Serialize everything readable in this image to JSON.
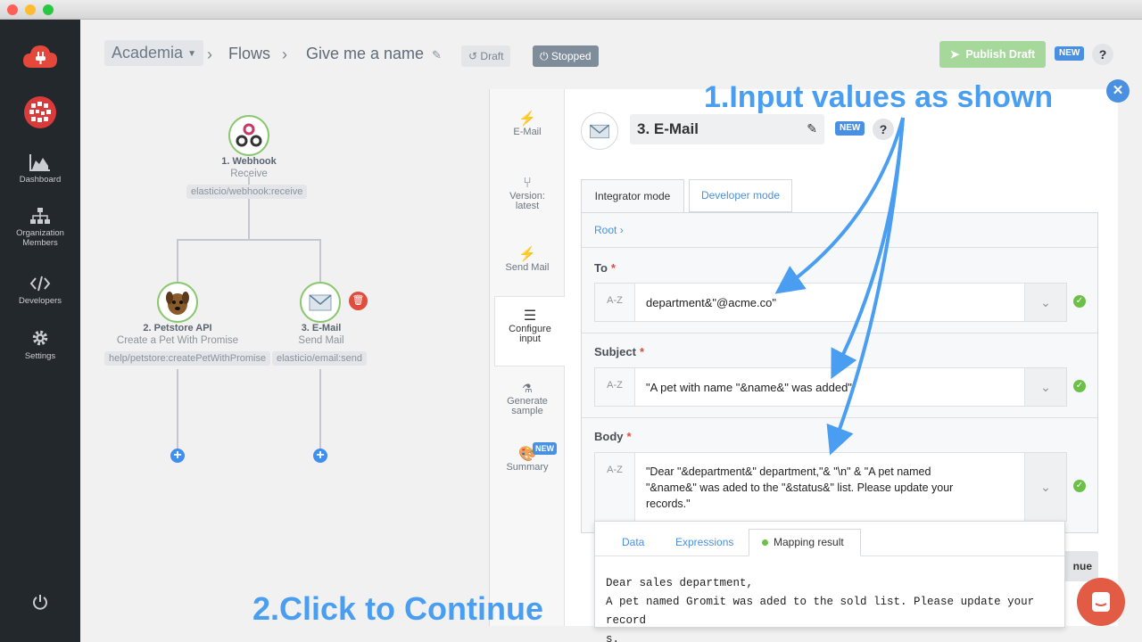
{
  "window": {
    "traffic_lights": [
      "#ff5f57",
      "#febc2e",
      "#28c840"
    ]
  },
  "sidebar": {
    "items": [
      {
        "label": "Dashboard",
        "icon": "area-chart-icon"
      },
      {
        "label": "Organization Members",
        "icon": "org-chart-icon"
      },
      {
        "label": "Developers",
        "icon": "code-icon"
      },
      {
        "label": "Settings",
        "icon": "gear-icon"
      }
    ],
    "logout_icon": "power-icon"
  },
  "header": {
    "workspace": "Academia",
    "flows": "Flows",
    "flow_name": "Give me a name",
    "draft_label": "Draft",
    "status_label": "Stopped",
    "publish_label": "Publish Draft",
    "new_badge": "NEW",
    "help": "?"
  },
  "flow": {
    "nodes": [
      {
        "title": "1. Webhook",
        "subtitle": "Receive",
        "path": "elasticio/webhook:receive"
      },
      {
        "title": "2. Petstore API",
        "subtitle": "Create a Pet With Promise",
        "path": "help/petstore:createPetWithPromise"
      },
      {
        "title": "3. E-Mail",
        "subtitle": "Send Mail",
        "path": "elasticio/email:send"
      }
    ]
  },
  "panel": {
    "steps": [
      {
        "label": "E-Mail",
        "icon": "bolt-icon"
      },
      {
        "label": "Version: latest",
        "icon": "branch-icon"
      },
      {
        "label": "Send Mail",
        "icon": "bolt-icon"
      },
      {
        "label": "Configure input",
        "icon": "menu-icon"
      },
      {
        "label": "Generate sample",
        "icon": "flask-icon"
      },
      {
        "label": "Summary",
        "icon": "palette-icon",
        "badge": "NEW"
      }
    ],
    "title": "3. E-Mail",
    "new_badge": "NEW",
    "help": "?",
    "modes": [
      "Integrator mode",
      "Developer mode"
    ],
    "breadcrumb": "Root",
    "fields": [
      {
        "label": "To",
        "type_tag": "A-Z",
        "value": "department&\"@acme.co\""
      },
      {
        "label": "Subject",
        "type_tag": "A-Z",
        "value": "\"A pet with name \"&name&\" was added\""
      },
      {
        "label": "Body",
        "type_tag": "A-Z",
        "value_lines": [
          "\"Dear \"&department&\" department,\"& \"\\n\" & \"A pet named",
          "\"&name&\" was aded to the \"&status&\" list. Please update your",
          "records.\""
        ]
      }
    ],
    "result_tabs": [
      "Data",
      "Expressions",
      "Mapping result"
    ],
    "result_lines": [
      "Dear sales department,",
      "A pet named Gromit was aded to the sold list. Please update your record",
      "s."
    ],
    "continue_fragment": "nue"
  },
  "annotations": {
    "step1": "1.Input values as shown",
    "step2": "2.Click to Continue",
    "color": "#4a9ef1"
  }
}
